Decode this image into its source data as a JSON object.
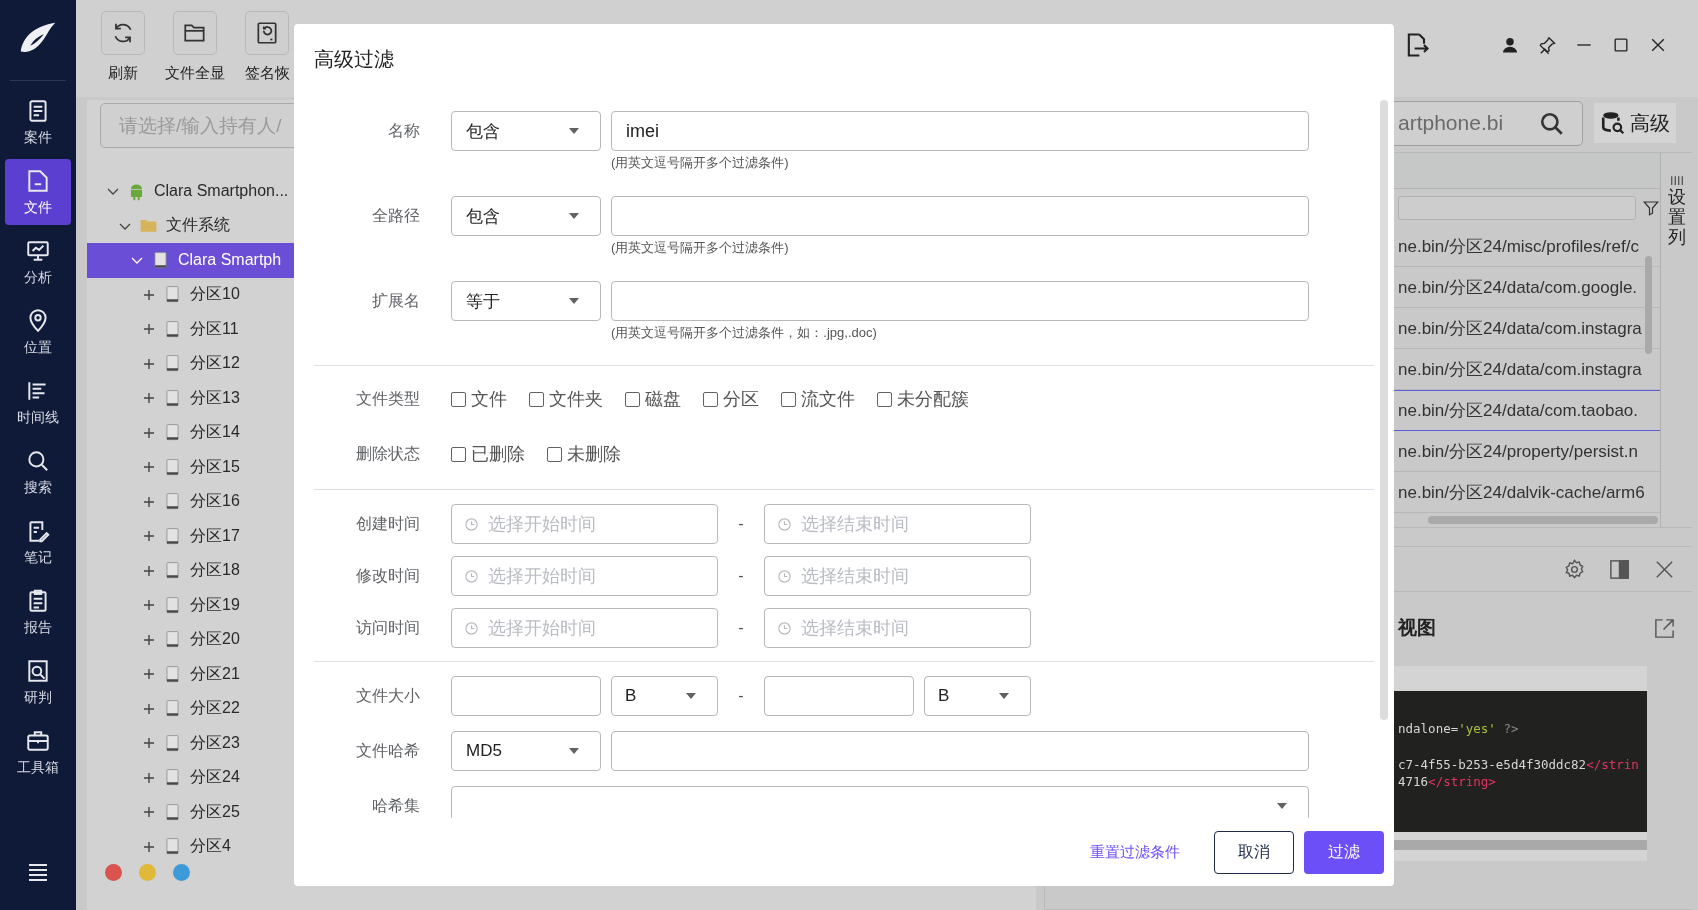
{
  "sidebar": {
    "items": [
      {
        "label": "案件",
        "selected": false
      },
      {
        "label": "文件",
        "selected": true
      },
      {
        "label": "分析",
        "selected": false
      },
      {
        "label": "位置",
        "selected": false
      },
      {
        "label": "时间线",
        "selected": false
      },
      {
        "label": "搜索",
        "selected": false
      },
      {
        "label": "笔记",
        "selected": false
      },
      {
        "label": "报告",
        "selected": false
      },
      {
        "label": "研判",
        "selected": false
      },
      {
        "label": "工具箱",
        "selected": false
      }
    ]
  },
  "toolbar": {
    "buttons": [
      {
        "label": "刷新"
      },
      {
        "label": "文件全显"
      },
      {
        "label": "签名恢"
      }
    ]
  },
  "tree": {
    "search": {
      "placeholder": "请选择/输入持有人/"
    },
    "items": [
      {
        "label": "Clara Smartphon...",
        "kind": "device",
        "expanded": true,
        "selected": false,
        "children": [
          {
            "label": "文件系统",
            "kind": "folder",
            "expanded": true,
            "selected": false,
            "children": [
              {
                "label": "Clara Smartph",
                "kind": "drive",
                "expanded": true,
                "selected": true,
                "children": [
                  {
                    "label": "分区10",
                    "kind": "drive",
                    "expanded": false,
                    "selected": false
                  },
                  {
                    "label": "分区11",
                    "kind": "drive",
                    "expanded": false,
                    "selected": false
                  },
                  {
                    "label": "分区12",
                    "kind": "drive",
                    "expanded": false,
                    "selected": false
                  },
                  {
                    "label": "分区13",
                    "kind": "drive",
                    "expanded": false,
                    "selected": false
                  },
                  {
                    "label": "分区14",
                    "kind": "drive",
                    "expanded": false,
                    "selected": false
                  },
                  {
                    "label": "分区15",
                    "kind": "drive",
                    "expanded": false,
                    "selected": false
                  },
                  {
                    "label": "分区16",
                    "kind": "drive",
                    "expanded": false,
                    "selected": false
                  },
                  {
                    "label": "分区17",
                    "kind": "drive",
                    "expanded": false,
                    "selected": false
                  },
                  {
                    "label": "分区18",
                    "kind": "drive",
                    "expanded": false,
                    "selected": false
                  },
                  {
                    "label": "分区19",
                    "kind": "drive",
                    "expanded": false,
                    "selected": false
                  },
                  {
                    "label": "分区20",
                    "kind": "drive",
                    "expanded": false,
                    "selected": false
                  },
                  {
                    "label": "分区21",
                    "kind": "drive",
                    "expanded": false,
                    "selected": false
                  },
                  {
                    "label": "分区22",
                    "kind": "drive",
                    "expanded": false,
                    "selected": false
                  },
                  {
                    "label": "分区23",
                    "kind": "drive",
                    "expanded": false,
                    "selected": false
                  },
                  {
                    "label": "分区24",
                    "kind": "drive",
                    "expanded": false,
                    "selected": false
                  },
                  {
                    "label": "分区25",
                    "kind": "drive",
                    "expanded": false,
                    "selected": false
                  },
                  {
                    "label": "分区4",
                    "kind": "drive",
                    "expanded": false,
                    "selected": false
                  }
                ]
              }
            ]
          }
        ]
      }
    ]
  },
  "status_dots": [
    {
      "color": "#d9534f"
    },
    {
      "color": "#e0b83a"
    },
    {
      "color": "#3d9bd8"
    }
  ],
  "file_search": {
    "value": "artphone.bi"
  },
  "advanced_button": {
    "label": "高级"
  },
  "table": {
    "settings_label": "设置列",
    "rows": [
      {
        "path": "ne.bin/分区24/misc/profiles/ref/c",
        "selected": false
      },
      {
        "path": "ne.bin/分区24/data/com.google.",
        "selected": false
      },
      {
        "path": "ne.bin/分区24/data/com.instagra",
        "selected": false
      },
      {
        "path": "ne.bin/分区24/data/com.instagra",
        "selected": false
      },
      {
        "path": "ne.bin/分区24/data/com.taobao.",
        "selected": true
      },
      {
        "path": "ne.bin/分区24/property/persist.n",
        "selected": false
      },
      {
        "path": "ne.bin/分区24/dalvik-cache/arm6",
        "selected": false
      }
    ]
  },
  "preview": {
    "title": "视图",
    "code_lines": [
      [
        {
          "kind": "plain",
          "text": "ndalone="
        },
        {
          "kind": "string",
          "text": "'yes'"
        },
        {
          "kind": "meta",
          "text": " ?>"
        }
      ],
      [
        {
          "kind": "plain",
          "text": "c7-4f55-b253-e5d4f30ddc82"
        },
        {
          "kind": "tag",
          "text": "</strin"
        }
      ],
      [
        {
          "kind": "plain",
          "text": "4716"
        },
        {
          "kind": "tag",
          "text": "</string>"
        }
      ]
    ]
  },
  "dialog": {
    "title": "高级过滤",
    "text_filters": [
      {
        "label": "名称",
        "operator": "包含",
        "value": "imei",
        "hint": "(用英文逗号隔开多个过滤条件)"
      },
      {
        "label": "全路径",
        "operator": "包含",
        "hint": "(用英文逗号隔开多个过滤条件)"
      },
      {
        "label": "扩展名",
        "operator": "等于",
        "hint": "(用英文逗号隔开多个过滤条件，如：.jpg,.doc)"
      }
    ],
    "checkbox_groups": [
      {
        "label": "文件类型",
        "options": [
          {
            "label": "文件",
            "checked": false
          },
          {
            "label": "文件夹",
            "checked": false
          },
          {
            "label": "磁盘",
            "checked": false
          },
          {
            "label": "分区",
            "checked": false
          },
          {
            "label": "流文件",
            "checked": false
          },
          {
            "label": "未分配簇",
            "checked": false
          }
        ]
      },
      {
        "label": "删除状态",
        "options": [
          {
            "label": "已删除",
            "checked": false
          },
          {
            "label": "未删除",
            "checked": false
          }
        ]
      }
    ],
    "time_filters": [
      {
        "label": "创建时间",
        "start_placeholder": "选择开始时间",
        "separator": "-",
        "end_placeholder": "选择结束时间"
      },
      {
        "label": "修改时间",
        "start_placeholder": "选择开始时间",
        "separator": "-",
        "end_placeholder": "选择结束时间"
      },
      {
        "label": "访问时间",
        "start_placeholder": "选择开始时间",
        "separator": "-",
        "end_placeholder": "选择结束时间"
      }
    ],
    "size_filter": {
      "label": "文件大小",
      "min_unit": "B",
      "separator": "-",
      "max_unit": "B"
    },
    "hash_filter": {
      "label": "文件哈希",
      "algorithm": "MD5"
    },
    "hash_set": {
      "label": "哈希集"
    },
    "reset_link": "重置过滤条件",
    "cancel_button": "取消",
    "confirm_button": "过滤"
  }
}
